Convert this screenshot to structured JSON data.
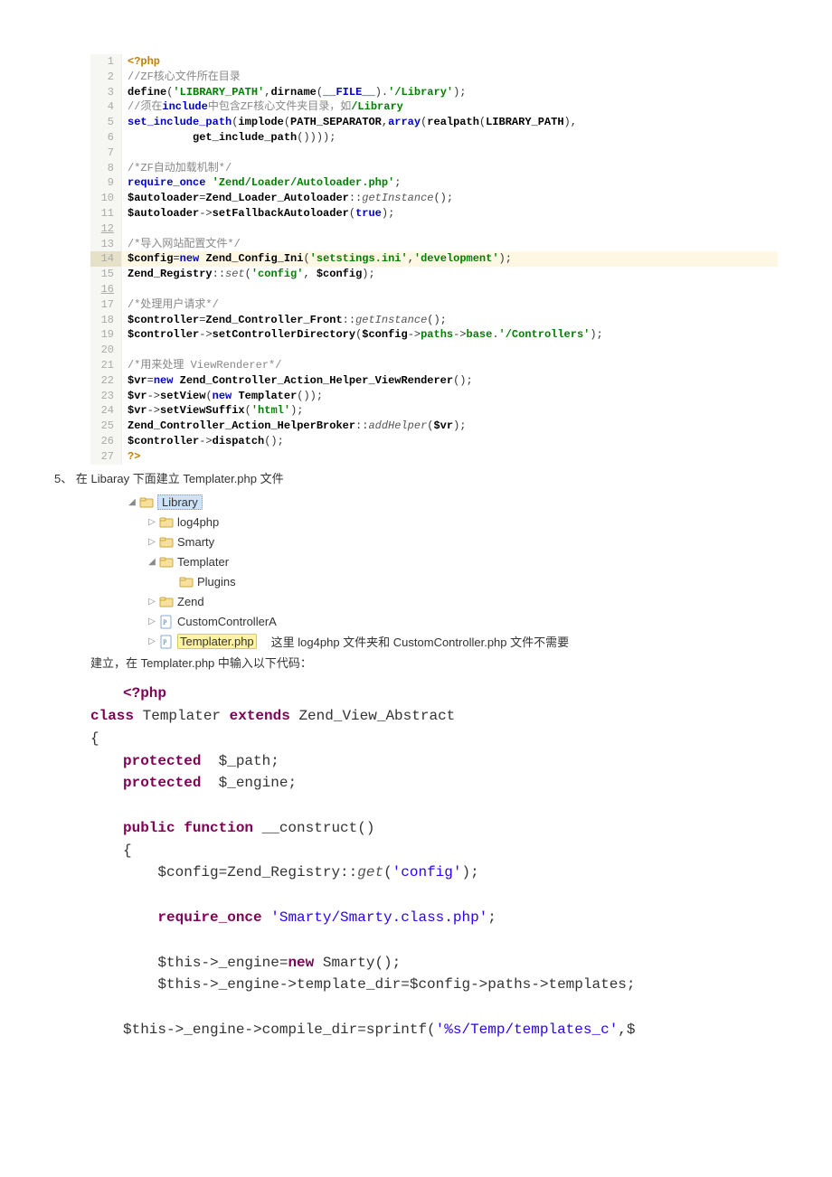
{
  "code1": {
    "lines": [
      {
        "n": 1,
        "tokens": [
          {
            "t": "<?php",
            "c": "php"
          }
        ]
      },
      {
        "n": 2,
        "tokens": [
          {
            "t": "//ZF核心文件所在目录",
            "c": "com"
          }
        ]
      },
      {
        "n": 3,
        "tokens": [
          {
            "t": "define",
            "c": "fn"
          },
          {
            "t": "("
          },
          {
            "t": "'LIBRARY_PATH'",
            "c": "str"
          },
          {
            "t": ","
          },
          {
            "t": "dirname",
            "c": "fn"
          },
          {
            "t": "("
          },
          {
            "t": "__FILE__",
            "c": "kw"
          },
          {
            "t": ")."
          },
          {
            "t": "'/Library'",
            "c": "str"
          },
          {
            "t": ");"
          }
        ]
      },
      {
        "n": 4,
        "tokens": [
          {
            "t": "//须在",
            "c": "com"
          },
          {
            "t": "include",
            "c": "kw"
          },
          {
            "t": "中包含ZF核心文件夹目录，如",
            "c": "com"
          },
          {
            "t": "/Library",
            "c": "str"
          }
        ]
      },
      {
        "n": 5,
        "tokens": [
          {
            "t": "set_include_path",
            "c": "kw"
          },
          {
            "t": "("
          },
          {
            "t": "implode",
            "c": "fn"
          },
          {
            "t": "("
          },
          {
            "t": "PATH_SEPARATOR",
            "c": "fn"
          },
          {
            "t": ","
          },
          {
            "t": "array",
            "c": "kw"
          },
          {
            "t": "("
          },
          {
            "t": "realpath",
            "c": "fn"
          },
          {
            "t": "("
          },
          {
            "t": "LIBRARY_PATH",
            "c": "fn"
          },
          {
            "t": "),"
          }
        ]
      },
      {
        "n": 6,
        "tokens": [
          {
            "t": "          "
          },
          {
            "t": "get_include_path",
            "c": "fn"
          },
          {
            "t": "())));"
          }
        ]
      },
      {
        "n": 7,
        "tokens": [
          {
            "t": ""
          }
        ]
      },
      {
        "n": 8,
        "tokens": [
          {
            "t": "/*ZF自动加载机制*/",
            "c": "com"
          }
        ]
      },
      {
        "n": 9,
        "tokens": [
          {
            "t": "require_once ",
            "c": "kw"
          },
          {
            "t": "'Zend/Loader/Autoloader.php'",
            "c": "str"
          },
          {
            "t": ";"
          }
        ]
      },
      {
        "n": 10,
        "tokens": [
          {
            "t": "$autoloader",
            "c": "fn"
          },
          {
            "t": "="
          },
          {
            "t": "Zend_Loader_Autoloader",
            "c": "cls"
          },
          {
            "t": "::"
          },
          {
            "t": "getInstance",
            "c": "st"
          },
          {
            "t": "();"
          }
        ]
      },
      {
        "n": 11,
        "tokens": [
          {
            "t": "$autoloader",
            "c": "fn"
          },
          {
            "t": "->",
            "c": ""
          },
          {
            "t": "setFallbackAutoloader",
            "c": "fn"
          },
          {
            "t": "("
          },
          {
            "t": "true",
            "c": "kw"
          },
          {
            "t": ");"
          }
        ]
      },
      {
        "n": 12,
        "tokens": [
          {
            "t": ""
          }
        ],
        "under": true
      },
      {
        "n": 13,
        "tokens": [
          {
            "t": "/*导入网站配置文件*/",
            "c": "com"
          }
        ]
      },
      {
        "n": 14,
        "hl": true,
        "tokens": [
          {
            "t": "$config",
            "c": "fn"
          },
          {
            "t": "="
          },
          {
            "t": "new ",
            "c": "kw"
          },
          {
            "t": "Zend_Config_Ini",
            "c": "cls"
          },
          {
            "t": "("
          },
          {
            "t": "'setstings.ini'",
            "c": "str"
          },
          {
            "t": ","
          },
          {
            "t": "'development'",
            "c": "str"
          },
          {
            "t": ");"
          }
        ]
      },
      {
        "n": 15,
        "tokens": [
          {
            "t": "Zend_Registry",
            "c": "cls"
          },
          {
            "t": "::"
          },
          {
            "t": "set",
            "c": "st"
          },
          {
            "t": "("
          },
          {
            "t": "'config'",
            "c": "str"
          },
          {
            "t": ", "
          },
          {
            "t": "$config",
            "c": "fn"
          },
          {
            "t": ");"
          }
        ]
      },
      {
        "n": 16,
        "tokens": [
          {
            "t": ""
          }
        ],
        "under": true
      },
      {
        "n": 17,
        "tokens": [
          {
            "t": "/*处理用户请求*/",
            "c": "com"
          }
        ]
      },
      {
        "n": 18,
        "tokens": [
          {
            "t": "$controller",
            "c": "fn"
          },
          {
            "t": "="
          },
          {
            "t": "Zend_Controller_Front",
            "c": "cls"
          },
          {
            "t": "::"
          },
          {
            "t": "getInstance",
            "c": "st"
          },
          {
            "t": "();"
          }
        ]
      },
      {
        "n": 19,
        "tokens": [
          {
            "t": "$controller",
            "c": "fn"
          },
          {
            "t": "->"
          },
          {
            "t": "setControllerDirectory",
            "c": "fn"
          },
          {
            "t": "("
          },
          {
            "t": "$config",
            "c": "fn"
          },
          {
            "t": "->"
          },
          {
            "t": "paths",
            "c": "str"
          },
          {
            "t": "->"
          },
          {
            "t": "base",
            "c": "str"
          },
          {
            "t": "."
          },
          {
            "t": "'/Controllers'",
            "c": "str"
          },
          {
            "t": ");"
          }
        ]
      },
      {
        "n": 20,
        "tokens": [
          {
            "t": ""
          }
        ]
      },
      {
        "n": 21,
        "tokens": [
          {
            "t": "/*用来处理 ViewRenderer*/",
            "c": "com"
          }
        ]
      },
      {
        "n": 22,
        "tokens": [
          {
            "t": "$vr",
            "c": "fn"
          },
          {
            "t": "="
          },
          {
            "t": "new ",
            "c": "kw"
          },
          {
            "t": "Zend_Controller_Action_Helper_ViewRenderer",
            "c": "cls"
          },
          {
            "t": "();"
          }
        ]
      },
      {
        "n": 23,
        "tokens": [
          {
            "t": "$vr",
            "c": "fn"
          },
          {
            "t": "->"
          },
          {
            "t": "setView",
            "c": "fn"
          },
          {
            "t": "("
          },
          {
            "t": "new ",
            "c": "kw"
          },
          {
            "t": "Templater",
            "c": "cls"
          },
          {
            "t": "());"
          }
        ]
      },
      {
        "n": 24,
        "tokens": [
          {
            "t": "$vr",
            "c": "fn"
          },
          {
            "t": "->"
          },
          {
            "t": "setViewSuffix",
            "c": "fn"
          },
          {
            "t": "("
          },
          {
            "t": "'html'",
            "c": "str"
          },
          {
            "t": ");"
          }
        ]
      },
      {
        "n": 25,
        "tokens": [
          {
            "t": "Zend_Controller_Action_HelperBroker",
            "c": "cls"
          },
          {
            "t": "::"
          },
          {
            "t": "addHelper",
            "c": "st"
          },
          {
            "t": "("
          },
          {
            "t": "$vr",
            "c": "fn"
          },
          {
            "t": ");"
          }
        ]
      },
      {
        "n": 26,
        "tokens": [
          {
            "t": "$controller",
            "c": "fn"
          },
          {
            "t": "->"
          },
          {
            "t": "dispatch",
            "c": "fn"
          },
          {
            "t": "();"
          }
        ]
      },
      {
        "n": 27,
        "tokens": [
          {
            "t": "?>",
            "c": "php"
          }
        ]
      }
    ]
  },
  "step5": {
    "prefix": "5、",
    "text": "在 Libaray 下面建立 Templater.php 文件"
  },
  "tree": {
    "items": [
      {
        "indent": 0,
        "expand": "▾",
        "icon": "folder",
        "label": "Library",
        "sel": "blue"
      },
      {
        "indent": 1,
        "expand": "▸",
        "icon": "folder",
        "label": "log4php"
      },
      {
        "indent": 1,
        "expand": "▸",
        "icon": "folder",
        "label": "Smarty"
      },
      {
        "indent": 1,
        "expand": "▾",
        "icon": "folder",
        "label": "Templater"
      },
      {
        "indent": 2,
        "expand": "",
        "icon": "folder",
        "label": "Plugins"
      },
      {
        "indent": 1,
        "expand": "▸",
        "icon": "folder",
        "label": "Zend"
      },
      {
        "indent": 1,
        "expand": "▸",
        "icon": "php",
        "label": "CustomControllerA"
      },
      {
        "indent": 1,
        "expand": "▸",
        "icon": "php",
        "label": "Templater.php",
        "sel": "yellow",
        "trail": "这里 log4php 文件夹和 CustomController.php 文件不需要"
      }
    ]
  },
  "after_tree": "建立，在 Templater.php 中输入以下代码：",
  "code2": {
    "lines": [
      [
        {
          "t": "<?php",
          "c": "kw2"
        }
      ],
      [
        {
          "t": "class ",
          "c": "kw2",
          "dedent": true
        },
        {
          "t": "Templater "
        },
        {
          "t": "extends ",
          "c": "kw2"
        },
        {
          "t": "Zend_View_Abstract"
        }
      ],
      [
        {
          "t": "{",
          "dedent": true
        }
      ],
      [
        {
          "t": "protected  ",
          "c": "kw2"
        },
        {
          "t": "$_path;"
        }
      ],
      [
        {
          "t": "protected  ",
          "c": "kw2"
        },
        {
          "t": "$_engine;"
        }
      ],
      [],
      [
        {
          "t": "public function ",
          "c": "kw2"
        },
        {
          "t": "__construct()"
        }
      ],
      [
        {
          "t": "{"
        }
      ],
      [
        {
          "t": "    $config=Zend_Registry::"
        },
        {
          "t": "get",
          "c": "call"
        },
        {
          "t": "("
        },
        {
          "t": "'config'",
          "c": "str2"
        },
        {
          "t": ");"
        }
      ],
      [],
      [
        {
          "t": "    "
        },
        {
          "t": "require_once ",
          "c": "kw2"
        },
        {
          "t": "'Smarty/Smarty.class.php'",
          "c": "str2"
        },
        {
          "t": ";"
        }
      ],
      [],
      [
        {
          "t": "    $this->_engine="
        },
        {
          "t": "new ",
          "c": "kw2"
        },
        {
          "t": "Smarty();"
        }
      ],
      [
        {
          "t": "    $this->_engine->template_dir=$config->paths->templates;"
        }
      ],
      [],
      [
        {
          "t": "$this->_engine->compile_dir=sprintf("
        },
        {
          "t": "'%s/Temp/templates_c'",
          "c": "str2"
        },
        {
          "t": ",$"
        }
      ]
    ]
  }
}
